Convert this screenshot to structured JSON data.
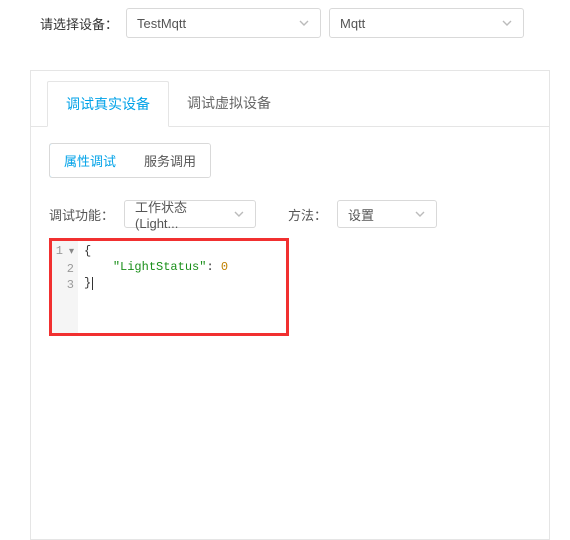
{
  "topLabel": "请选择设备：",
  "deviceSelect": {
    "value": "TestMqtt"
  },
  "protocolSelect": {
    "value": "Mqtt"
  },
  "tabs": {
    "real": {
      "label": "调试真实设备",
      "active": true
    },
    "virtual": {
      "label": "调试虚拟设备",
      "active": false
    }
  },
  "segButtons": {
    "attr": {
      "label": "属性调试",
      "active": true
    },
    "svc": {
      "label": "服务调用",
      "active": false
    }
  },
  "funcRow": {
    "label": "调试功能：",
    "select": "工作状态 (Light...",
    "methodLabel": "方法：",
    "methodValue": "设置"
  },
  "editor": {
    "gutter1": "1",
    "gutter2": "2",
    "gutter3": "3",
    "line1": "{",
    "line2key": "\"LightStatus\"",
    "line2sep": ": ",
    "line2val": "0",
    "line3": "}"
  }
}
